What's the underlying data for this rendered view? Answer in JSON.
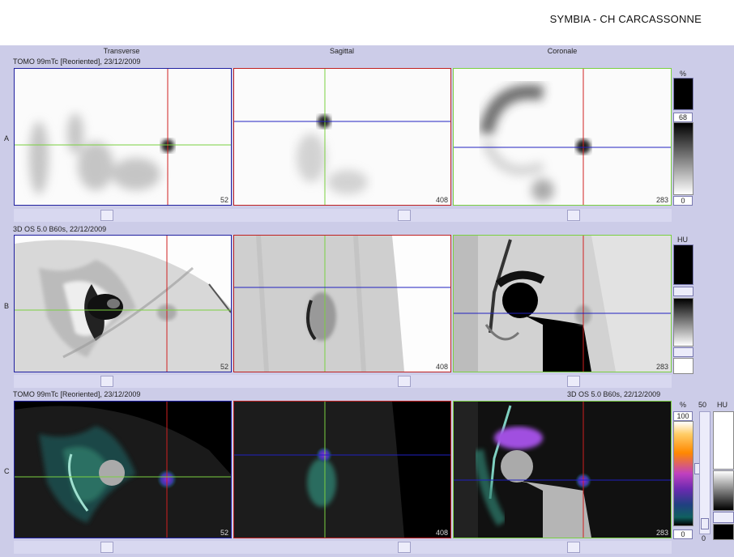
{
  "header": {
    "title": "SYMBIA - CH CARCASSONNE"
  },
  "columns": {
    "transverse": "Transverse",
    "sagittal": "Sagittal",
    "coronal": "Coronale"
  },
  "rows": {
    "a": {
      "letter": "A",
      "caption": "TOMO 99mTc [Reoriented], 23/12/2009"
    },
    "b": {
      "letter": "B",
      "caption": "3D  OS  5.0  B60s, 22/12/2009"
    },
    "c": {
      "letter": "C",
      "caption_left": "TOMO 99mTc [Reoriented], 23/12/2009",
      "caption_right": "3D  OS  5.0  B60s, 22/12/2009"
    }
  },
  "slices": {
    "transverse": "52",
    "sagittal": "408",
    "coronal": "283"
  },
  "colorbars": {
    "a": {
      "unit": "%",
      "level": "68",
      "min": "0"
    },
    "b": {
      "unit": "HU"
    },
    "c": {
      "unit_left": "%",
      "max": "100",
      "min": "0",
      "mid_label": "50",
      "unit_right": "HU",
      "bottom_label": "0"
    }
  },
  "colors": {
    "red_line": "#d02020",
    "green_line": "#7ad040",
    "blue_line": "#2020c0",
    "panel_bg": "#cccce8"
  }
}
